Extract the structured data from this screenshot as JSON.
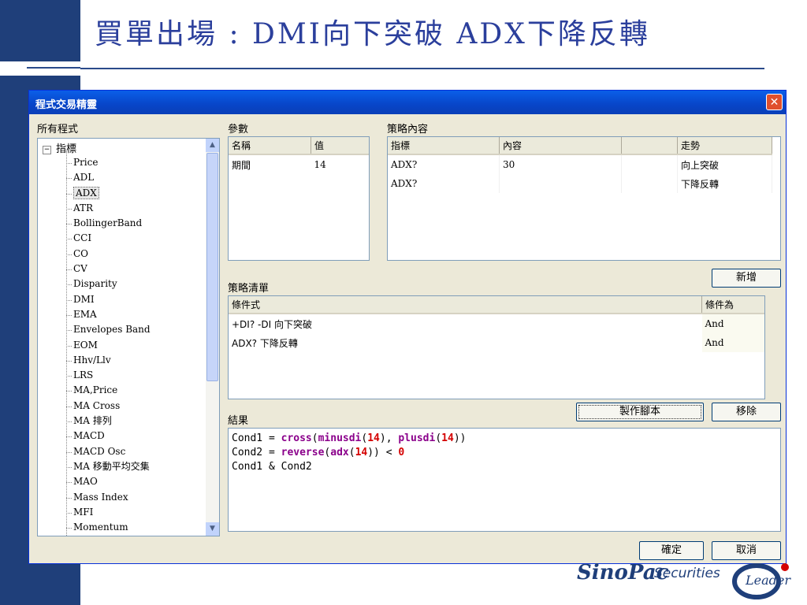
{
  "slide": {
    "title": "買單出場 : DMI向下突破  ADX下降反轉"
  },
  "dialog": {
    "title": "程式交易精靈",
    "close_symbol": "✕",
    "all_programs_label": "所有程式",
    "params_label": "參數",
    "strategy_content_label": "策略內容",
    "strategy_list_label": "策略清單",
    "result_label": "結果"
  },
  "tree": {
    "root_label": "指標",
    "items": [
      "Price",
      "ADL",
      "ADX",
      "ATR",
      "BollingerBand",
      "CCI",
      "CO",
      "CV",
      "Disparity",
      "DMI",
      "EMA",
      "Envelopes Band",
      "EOM",
      "Hhv/Llv",
      "LRS",
      "MA,Price",
      "MA Cross",
      "MA 排列",
      "MACD",
      "MACD Osc",
      "MA 移動平均交集",
      "MAO",
      "Mass Index",
      "MFI",
      "Momentum"
    ],
    "selected": "ADX"
  },
  "params": {
    "headers": [
      "名稱",
      "值"
    ],
    "rows": [
      [
        "期間",
        "14"
      ]
    ]
  },
  "strategy": {
    "headers": [
      "指標",
      "內容",
      "",
      "走勢"
    ],
    "rows": [
      [
        "ADX?",
        "30",
        "",
        "向上突破"
      ],
      [
        "ADX?",
        "",
        "",
        "下降反轉"
      ]
    ]
  },
  "list": {
    "headers": [
      "條件式",
      "條件為"
    ],
    "rows": [
      [
        "+DI? -DI 向下突破",
        "And"
      ],
      [
        "ADX? 下降反轉",
        "And"
      ]
    ]
  },
  "buttons": {
    "add": "新增",
    "make_script": "製作腳本",
    "remove": "移除",
    "ok": "確定",
    "cancel": "取消"
  },
  "result": {
    "lines": [
      "Cond1 = cross(minusdi(14), plusdi(14))",
      "Cond2 = reverse(adx(14)) < 0",
      "Cond1 & Cond2"
    ]
  },
  "logos": {
    "sinopac": "SinoPac",
    "securities": "Securities",
    "leader": "Leader"
  },
  "colors": {
    "slide_title": "#2b3f9c",
    "left_bar": "#1f3f7a",
    "titlebar": "#0a5fe8",
    "keyword": "#8b008b",
    "number": "#d40000"
  }
}
